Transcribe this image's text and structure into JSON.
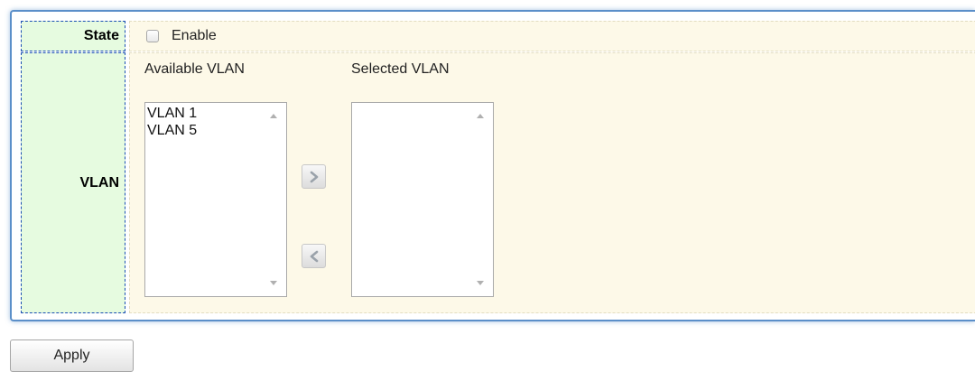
{
  "form": {
    "state_label": "State",
    "enable_label": "Enable",
    "enable_checked": false,
    "vlan_label": "VLAN"
  },
  "vlan": {
    "available_title": "Available VLAN",
    "selected_title": "Selected VLAN",
    "available_items": [
      "VLAN 1",
      "VLAN 5"
    ],
    "selected_items": [],
    "add_icon": "chevron-right-icon",
    "remove_icon": "chevron-left-icon"
  },
  "actions": {
    "apply_label": "Apply"
  },
  "colors": {
    "label_bg": "#e6fbe0",
    "value_bg": "#fdf9e8",
    "panel_border": "#5b8fc9",
    "label_border": "#1a4fb3"
  }
}
